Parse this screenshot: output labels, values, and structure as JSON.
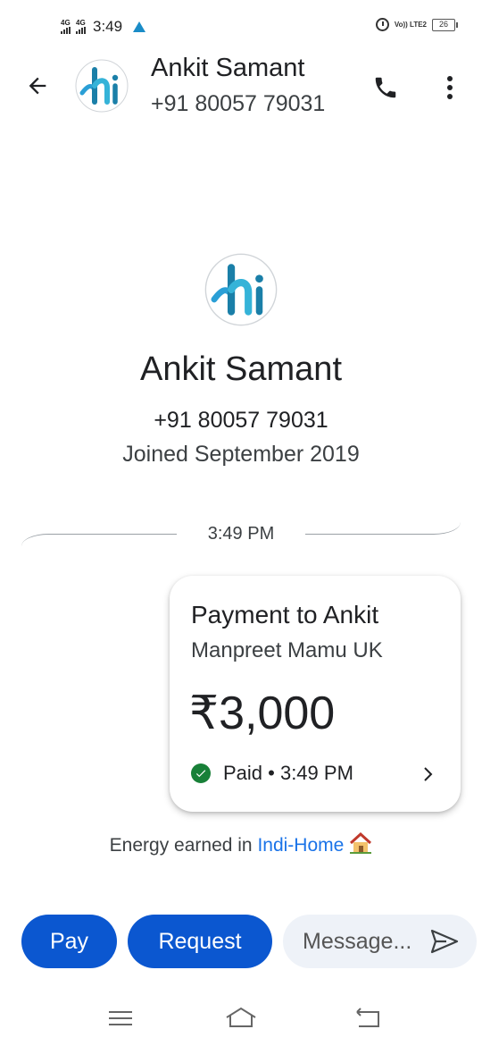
{
  "status_bar": {
    "network1": "4G",
    "network2": "4G",
    "time": "3:49",
    "volte": "Vo)) LTE2",
    "battery": "26"
  },
  "header": {
    "contact_name": "Ankit Samant",
    "contact_phone": "+91 80057 79031",
    "avatar_text": "hi"
  },
  "profile": {
    "avatar_text": "hi",
    "name": "Ankit Samant",
    "phone": "+91 80057 79031",
    "joined": "Joined September 2019"
  },
  "conversation": {
    "timestamp": "3:49 PM"
  },
  "payment": {
    "title": "Payment to Ankit",
    "note": "Manpreet Mamu UK",
    "amount": "₹3,000",
    "status": "Paid • 3:49 PM",
    "status_color": "#188038"
  },
  "energy": {
    "prefix": "Energy earned in ",
    "link": "Indi-Home"
  },
  "actions": {
    "pay_label": "Pay",
    "request_label": "Request",
    "message_placeholder": "Message...",
    "accent": "#0b57d0"
  },
  "icons": {
    "back": "arrow-left-icon",
    "call": "phone-icon",
    "more": "more-vert-icon",
    "check": "check-circle-icon",
    "chevron": "chevron-right-icon",
    "send": "send-icon",
    "house": "house-icon"
  }
}
